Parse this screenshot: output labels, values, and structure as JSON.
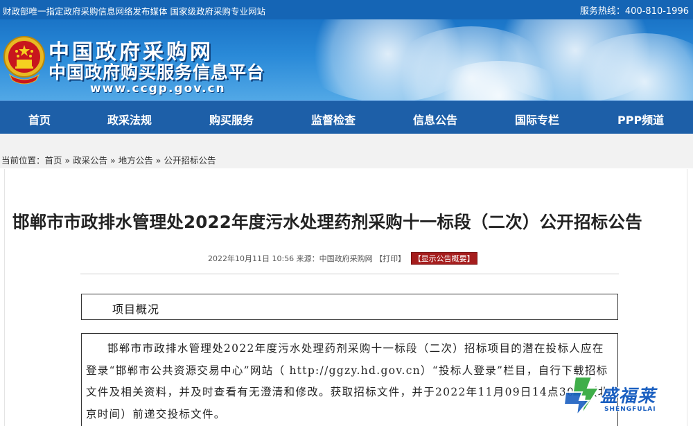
{
  "topbar": {
    "left_text": "财政部唯一指定政府采购信息网络发布媒体 国家级政府采购专业网站",
    "hotline": "服务热线：400-810-1996"
  },
  "banner": {
    "title_cn": "中国政府采购网",
    "subtitle_cn": "中国政府购买服务信息平台",
    "url": "www.ccgp.gov.cn"
  },
  "nav": {
    "items": [
      "首页",
      "政采法规",
      "购买服务",
      "监督检查",
      "信息公告",
      "国际专栏",
      "PPP频道"
    ]
  },
  "breadcrumb": {
    "prefix": "当前位置：",
    "items": [
      "首页",
      "政采公告",
      "地方公告",
      "公开招标公告"
    ],
    "separator": "»"
  },
  "article": {
    "title": "邯郸市市政排水管理处2022年度污水处理药剂采购十一标段（二次）公开招标公告",
    "meta_date": "2022年10月11日 10:56 来源：中国政府采购网",
    "print_label": "【打印】",
    "summary_label": "【显示公告概要】",
    "section_heading": "项目概况",
    "body_text": "邯郸市市政排水管理处2022年度污水处理药剂采购十一标段（二次）招标项目的潜在投标人应在登录“邯郸市公共资源交易中心”网站（ http://ggzy.hd.gov.cn）“投标人登录”栏目，自行下载招标文件及相关资料，并及时查看有无澄清和修改。获取招标文件，并于2022年11月09日14点30分（北京时间）前递交投标文件。"
  },
  "watermark": {
    "brand": "盛福莱",
    "brand_en": "SHENGFULAI"
  },
  "colors": {
    "topbar": "#1565b5",
    "nav": "#1d5fa8",
    "summary_badge": "#a51d1d"
  }
}
